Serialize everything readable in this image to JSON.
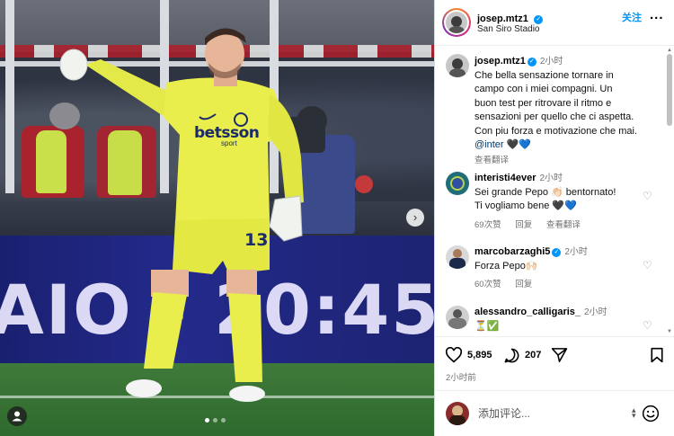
{
  "post": {
    "username": "josep.mtz1",
    "location": "San Siro Stadio",
    "follow_label": "关注",
    "more_label": "...",
    "caption_time": "2小时",
    "caption_lines": [
      "Che bella sensazione tornare in",
      "campo con i miei compagni. Un",
      "buon test per ritrovare il ritmo e",
      "sensazioni per quello che ci aspetta.",
      "Con piu forza e motivazione che mai."
    ],
    "caption_mention": "@inter",
    "caption_emoji": "🖤💙",
    "see_translation": "查看翻译",
    "image": {
      "jersey_sponsor": "betsson",
      "jersey_sponsor_sub": "sport",
      "shorts_number": "13",
      "board_text": "AIO - 20:45"
    }
  },
  "comments": [
    {
      "username": "interisti4ever",
      "time": "2小时",
      "lines": [
        "Sei grande Pepo 👏🏻 bentornato!",
        "Ti vogliamo bene 🖤💙"
      ],
      "likes": "69次赞",
      "reply": "回复",
      "translate": "查看翻译",
      "verified": false
    },
    {
      "username": "marcobarzaghi5",
      "time": "2小时",
      "lines": [
        "Forza Pepo🙌🏻"
      ],
      "likes": "60次赞",
      "reply": "回复",
      "translate": "",
      "verified": true
    },
    {
      "username": "alessandro_calligaris_",
      "time": "2小时",
      "lines": [
        "⏳✅"
      ],
      "likes": "",
      "reply": "",
      "translate": "",
      "verified": false
    }
  ],
  "actions": {
    "likes_count": "5,895",
    "comments_count": "207",
    "time_ago": "2小时前"
  },
  "compose": {
    "placeholder": "添加评论...",
    "emoji_label": "😊"
  },
  "colors": {
    "accent": "#0095f6",
    "verified": "#0095f6",
    "kit_yellow": "#e9ee4d",
    "led_board": "#232a8a"
  }
}
